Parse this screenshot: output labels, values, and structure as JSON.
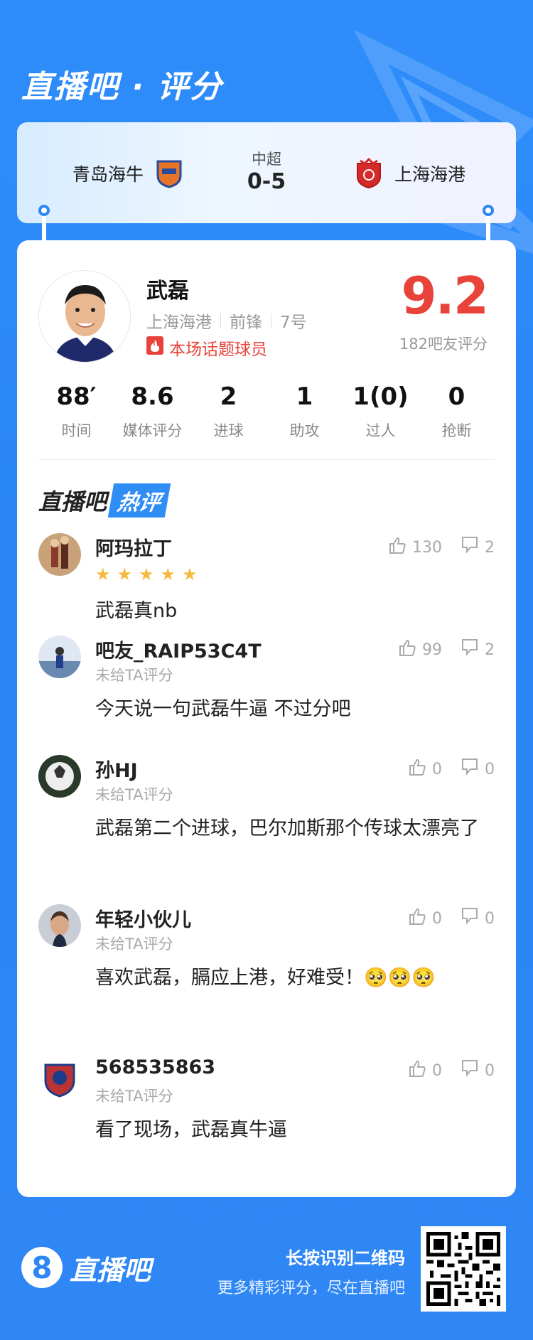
{
  "header": {
    "title": "直播吧 · 评分"
  },
  "match": {
    "home_team": "青岛海牛",
    "league": "中超",
    "score": "0-5",
    "away_team": "上海海港",
    "colors": {
      "home_crest": "#e8742a",
      "away_crest": "#d42a2a"
    }
  },
  "player": {
    "name": "武磊",
    "club": "上海海港",
    "position": "前锋",
    "number": "7号",
    "tag": "本场话题球员",
    "rating": "9.2",
    "rating_sub": "182吧友评分",
    "stats": [
      {
        "value": "88′",
        "label": "时间"
      },
      {
        "value": "8.6",
        "label": "媒体评分"
      },
      {
        "value": "2",
        "label": "进球"
      },
      {
        "value": "1",
        "label": "助攻"
      },
      {
        "value": "1(0)",
        "label": "过人"
      },
      {
        "value": "0",
        "label": "抢断"
      }
    ]
  },
  "hot_comments": {
    "title_a": "直播吧",
    "title_b": "热评",
    "items": [
      {
        "user": "阿玛拉丁",
        "stars": 5,
        "sub": "",
        "text": "武磊真nb",
        "likes": "130",
        "dislikes": "2"
      },
      {
        "user": "吧友_RAIP53C4T",
        "sub": "未给TA评分",
        "text": "今天说一句武磊牛逼 不过分吧",
        "likes": "99",
        "dislikes": "2"
      },
      {
        "user": "孙HJ",
        "sub": "未给TA评分",
        "text": "武磊第二个进球，巴尔加斯那个传球太漂亮了",
        "likes": "0",
        "dislikes": "0"
      },
      {
        "user": "年轻小伙儿",
        "sub": "未给TA评分",
        "text": "喜欢武磊，膈应上港，好难受！🥺🥺🥺",
        "likes": "0",
        "dislikes": "0"
      },
      {
        "user": "568535863",
        "sub": "未给TA评分",
        "text": "看了现场，武磊真牛逼",
        "likes": "0",
        "dislikes": "0"
      }
    ]
  },
  "footer": {
    "logo_char": "8",
    "logo_text": "直播吧",
    "tip1": "长按识别二维码",
    "tip2": "更多精彩评分，尽在直播吧"
  },
  "colors": {
    "accent": "#2f8df6",
    "rating": "#e8433a",
    "star": "#f6b93b"
  }
}
